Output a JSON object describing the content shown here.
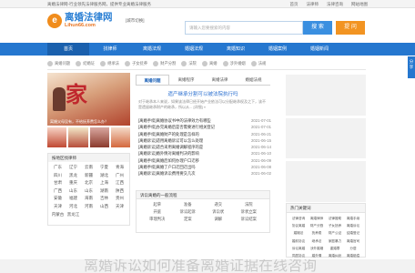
{
  "topbar": {
    "slogan": "离婚法律网-行业领先法律服务网，提供专业离婚法律服务",
    "links": [
      "首页",
      "法律师",
      "法律咨询",
      "网站地图"
    ]
  },
  "header": {
    "logo_badge": "e",
    "logo_title": "离婚法律网",
    "logo_domain": "Lihun66.com",
    "city": "[城市切换]",
    "search_placeholder": "请输入您要搜索的内容",
    "search_button": "搜 索",
    "ask_button": "提 问"
  },
  "nav": {
    "items": [
      "首页",
      "找律师",
      "离婚法规",
      "婚姻法规",
      "离婚知识",
      "婚姻案例",
      "婚姻新闻"
    ]
  },
  "subnav": {
    "items": [
      "离婚问题",
      "结婚证",
      "继承法",
      "子女抚养",
      "财产分割",
      "法院",
      "离婚",
      "涉外婚姻",
      "法规"
    ]
  },
  "banner": {
    "big_text": "家",
    "caption": "离婚父母没有，不给抚养费怎么办？"
  },
  "regions": {
    "title": "按地区找律师",
    "items": [
      "广东",
      "辽宁",
      "云南",
      "宁夏",
      "青海",
      "四川",
      "黑龙",
      "新疆",
      "湖北",
      "广州",
      "甘肃",
      "重庆",
      "北京",
      "上海",
      "江西",
      "广西",
      "山东",
      "山东",
      "湖南",
      "陕西",
      "安徽",
      "福建",
      "海南",
      "吉林",
      "贵州",
      "天津",
      "河北",
      "河南",
      "山西",
      "天津",
      "内蒙古",
      "黑龙江"
    ]
  },
  "tabs": [
    "离婚问题",
    "离婚程序",
    "离婚法律",
    "婚姻法规"
  ],
  "headline": "遗产继承分割可以被法院执行吗",
  "lead": "对于继承本人来说，如果该法律已经开始产业依法可以分配继承权及之下，该不是遗留继承财产的继承，所以从... [详细] »",
  "articles": [
    {
      "title": "[离婚手续]离婚协议书中的法律效力有哪些",
      "date": "2021-07-01"
    },
    {
      "title": "[离婚手续]办完离婚后是否需要进行相关登记",
      "date": "2021-07-01"
    },
    {
      "title": "[离婚手续]离婚财产的处理是怎样的",
      "date": "2021-06-21"
    },
    {
      "title": "[离婚诉讼]适用离婚诉讼可以怎么处理",
      "date": "2021-06-15"
    },
    {
      "title": "[离婚诉讼]适合采用离婚调解程序的是",
      "date": "2021-06-14"
    },
    {
      "title": "[离婚诉讼]婚外情对离婚判决的影响",
      "date": "2021-06-10"
    },
    {
      "title": "[离婚手续]离婚后如何办理户口迁移",
      "date": "2021-06-09"
    },
    {
      "title": "[离婚手续]离婚了户口迁回迁出吗",
      "date": "2021-06-08"
    },
    {
      "title": "[离婚诉讼]离婚诉讼费用要交几次",
      "date": "2021-06-02"
    }
  ],
  "process": {
    "title": "诉讼离婚的一般流程",
    "items": [
      "起草",
      "准备",
      "递交",
      "法院",
      "开庭",
      "诉讼起诉",
      "诉讼状",
      "诉状立案",
      "审理判决",
      "定案",
      "调解",
      "诉讼结案"
    ]
  },
  "hot": {
    "title": "热门关键词",
    "items": [
      "法律咨询",
      "离婚律师",
      "法律援助",
      "离婚手续",
      "协议离婚",
      "财产分割",
      "子女抚养",
      "离婚诉讼",
      "婚姻法",
      "抚养费",
      "财产公证",
      "结婚登记",
      "婚前协议",
      "继承法",
      "家庭暴力",
      "离婚官司",
      "诉讼离婚",
      "涉外婚姻",
      "重婚罪",
      "分居",
      "同居协议",
      "婚外情",
      "离婚纠纷",
      "离婚赔偿"
    ]
  },
  "share": "分享",
  "bottom_text": "离婚诉讼如何准备离婚证据在线咨询"
}
